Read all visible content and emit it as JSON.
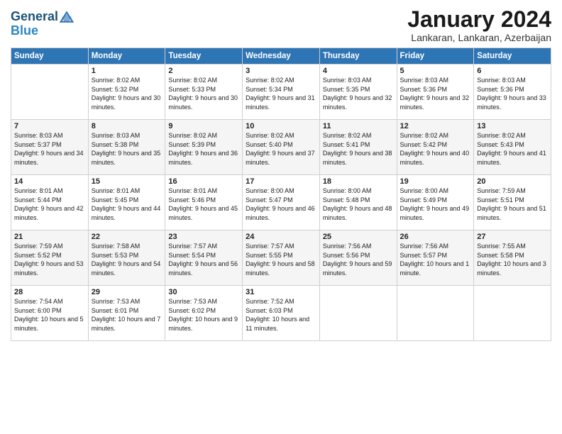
{
  "header": {
    "logo_line1": "General",
    "logo_line2": "Blue",
    "month_title": "January 2024",
    "subtitle": "Lankaran, Lankaran, Azerbaijan"
  },
  "days_of_week": [
    "Sunday",
    "Monday",
    "Tuesday",
    "Wednesday",
    "Thursday",
    "Friday",
    "Saturday"
  ],
  "weeks": [
    [
      {
        "day": "",
        "sunrise": "",
        "sunset": "",
        "daylight": ""
      },
      {
        "day": "1",
        "sunrise": "Sunrise: 8:02 AM",
        "sunset": "Sunset: 5:32 PM",
        "daylight": "Daylight: 9 hours and 30 minutes."
      },
      {
        "day": "2",
        "sunrise": "Sunrise: 8:02 AM",
        "sunset": "Sunset: 5:33 PM",
        "daylight": "Daylight: 9 hours and 30 minutes."
      },
      {
        "day": "3",
        "sunrise": "Sunrise: 8:02 AM",
        "sunset": "Sunset: 5:34 PM",
        "daylight": "Daylight: 9 hours and 31 minutes."
      },
      {
        "day": "4",
        "sunrise": "Sunrise: 8:03 AM",
        "sunset": "Sunset: 5:35 PM",
        "daylight": "Daylight: 9 hours and 32 minutes."
      },
      {
        "day": "5",
        "sunrise": "Sunrise: 8:03 AM",
        "sunset": "Sunset: 5:36 PM",
        "daylight": "Daylight: 9 hours and 32 minutes."
      },
      {
        "day": "6",
        "sunrise": "Sunrise: 8:03 AM",
        "sunset": "Sunset: 5:36 PM",
        "daylight": "Daylight: 9 hours and 33 minutes."
      }
    ],
    [
      {
        "day": "7",
        "sunrise": "Sunrise: 8:03 AM",
        "sunset": "Sunset: 5:37 PM",
        "daylight": "Daylight: 9 hours and 34 minutes."
      },
      {
        "day": "8",
        "sunrise": "Sunrise: 8:03 AM",
        "sunset": "Sunset: 5:38 PM",
        "daylight": "Daylight: 9 hours and 35 minutes."
      },
      {
        "day": "9",
        "sunrise": "Sunrise: 8:02 AM",
        "sunset": "Sunset: 5:39 PM",
        "daylight": "Daylight: 9 hours and 36 minutes."
      },
      {
        "day": "10",
        "sunrise": "Sunrise: 8:02 AM",
        "sunset": "Sunset: 5:40 PM",
        "daylight": "Daylight: 9 hours and 37 minutes."
      },
      {
        "day": "11",
        "sunrise": "Sunrise: 8:02 AM",
        "sunset": "Sunset: 5:41 PM",
        "daylight": "Daylight: 9 hours and 38 minutes."
      },
      {
        "day": "12",
        "sunrise": "Sunrise: 8:02 AM",
        "sunset": "Sunset: 5:42 PM",
        "daylight": "Daylight: 9 hours and 40 minutes."
      },
      {
        "day": "13",
        "sunrise": "Sunrise: 8:02 AM",
        "sunset": "Sunset: 5:43 PM",
        "daylight": "Daylight: 9 hours and 41 minutes."
      }
    ],
    [
      {
        "day": "14",
        "sunrise": "Sunrise: 8:01 AM",
        "sunset": "Sunset: 5:44 PM",
        "daylight": "Daylight: 9 hours and 42 minutes."
      },
      {
        "day": "15",
        "sunrise": "Sunrise: 8:01 AM",
        "sunset": "Sunset: 5:45 PM",
        "daylight": "Daylight: 9 hours and 44 minutes."
      },
      {
        "day": "16",
        "sunrise": "Sunrise: 8:01 AM",
        "sunset": "Sunset: 5:46 PM",
        "daylight": "Daylight: 9 hours and 45 minutes."
      },
      {
        "day": "17",
        "sunrise": "Sunrise: 8:00 AM",
        "sunset": "Sunset: 5:47 PM",
        "daylight": "Daylight: 9 hours and 46 minutes."
      },
      {
        "day": "18",
        "sunrise": "Sunrise: 8:00 AM",
        "sunset": "Sunset: 5:48 PM",
        "daylight": "Daylight: 9 hours and 48 minutes."
      },
      {
        "day": "19",
        "sunrise": "Sunrise: 8:00 AM",
        "sunset": "Sunset: 5:49 PM",
        "daylight": "Daylight: 9 hours and 49 minutes."
      },
      {
        "day": "20",
        "sunrise": "Sunrise: 7:59 AM",
        "sunset": "Sunset: 5:51 PM",
        "daylight": "Daylight: 9 hours and 51 minutes."
      }
    ],
    [
      {
        "day": "21",
        "sunrise": "Sunrise: 7:59 AM",
        "sunset": "Sunset: 5:52 PM",
        "daylight": "Daylight: 9 hours and 53 minutes."
      },
      {
        "day": "22",
        "sunrise": "Sunrise: 7:58 AM",
        "sunset": "Sunset: 5:53 PM",
        "daylight": "Daylight: 9 hours and 54 minutes."
      },
      {
        "day": "23",
        "sunrise": "Sunrise: 7:57 AM",
        "sunset": "Sunset: 5:54 PM",
        "daylight": "Daylight: 9 hours and 56 minutes."
      },
      {
        "day": "24",
        "sunrise": "Sunrise: 7:57 AM",
        "sunset": "Sunset: 5:55 PM",
        "daylight": "Daylight: 9 hours and 58 minutes."
      },
      {
        "day": "25",
        "sunrise": "Sunrise: 7:56 AM",
        "sunset": "Sunset: 5:56 PM",
        "daylight": "Daylight: 9 hours and 59 minutes."
      },
      {
        "day": "26",
        "sunrise": "Sunrise: 7:56 AM",
        "sunset": "Sunset: 5:57 PM",
        "daylight": "Daylight: 10 hours and 1 minute."
      },
      {
        "day": "27",
        "sunrise": "Sunrise: 7:55 AM",
        "sunset": "Sunset: 5:58 PM",
        "daylight": "Daylight: 10 hours and 3 minutes."
      }
    ],
    [
      {
        "day": "28",
        "sunrise": "Sunrise: 7:54 AM",
        "sunset": "Sunset: 6:00 PM",
        "daylight": "Daylight: 10 hours and 5 minutes."
      },
      {
        "day": "29",
        "sunrise": "Sunrise: 7:53 AM",
        "sunset": "Sunset: 6:01 PM",
        "daylight": "Daylight: 10 hours and 7 minutes."
      },
      {
        "day": "30",
        "sunrise": "Sunrise: 7:53 AM",
        "sunset": "Sunset: 6:02 PM",
        "daylight": "Daylight: 10 hours and 9 minutes."
      },
      {
        "day": "31",
        "sunrise": "Sunrise: 7:52 AM",
        "sunset": "Sunset: 6:03 PM",
        "daylight": "Daylight: 10 hours and 11 minutes."
      },
      {
        "day": "",
        "sunrise": "",
        "sunset": "",
        "daylight": ""
      },
      {
        "day": "",
        "sunrise": "",
        "sunset": "",
        "daylight": ""
      },
      {
        "day": "",
        "sunrise": "",
        "sunset": "",
        "daylight": ""
      }
    ]
  ]
}
